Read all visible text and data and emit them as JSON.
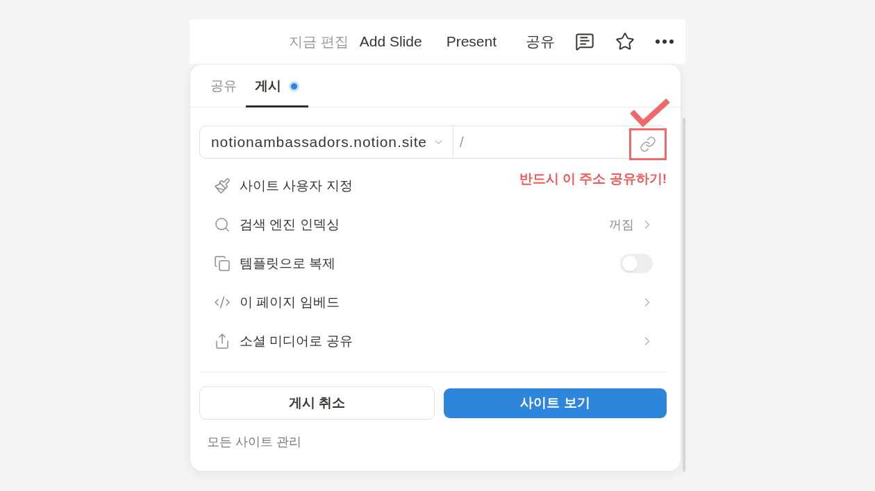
{
  "topbar": {
    "status": "지금 편집",
    "buttons": [
      "Add Slide",
      "Present",
      "공유"
    ]
  },
  "publish_panel": {
    "tabs": [
      {
        "label": "공유",
        "selected": false,
        "indicator": false
      },
      {
        "label": "게시",
        "selected": true,
        "indicator": true
      }
    ],
    "url": {
      "domain": "notionambassadors.notion.site",
      "path": "/"
    },
    "annotation": {
      "text": "반드시 이 주소 공유하기!"
    },
    "menu": [
      {
        "kind": "plain",
        "label": "사이트 사용자 지정"
      },
      {
        "kind": "value",
        "label": "검색 엔진 인덱싱",
        "value": "꺼짐"
      },
      {
        "kind": "toggle",
        "label": "템플릿으로 복제",
        "on": false
      },
      {
        "kind": "link",
        "label": "이 페이지 임베드"
      },
      {
        "kind": "link",
        "label": "소셜 미디어로 공유"
      }
    ],
    "buttons": [
      {
        "kind": "secondary",
        "label": "게시 취소"
      },
      {
        "kind": "primary",
        "label": "사이트 보기"
      }
    ],
    "footer_link": "모든 사이트 관리"
  }
}
